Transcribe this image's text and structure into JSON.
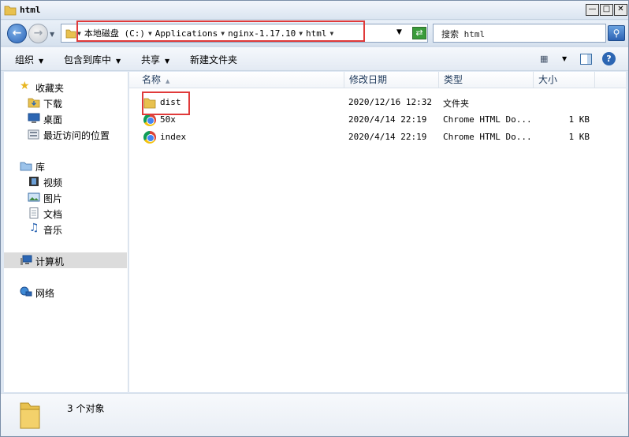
{
  "window": {
    "title": "html",
    "min_glyph": "—",
    "max_glyph": "□",
    "close_glyph": "✕"
  },
  "address": {
    "crumbs": [
      "本地磁盘 (C:)",
      "Applications",
      "nginx-1.17.10",
      "html"
    ],
    "dropdown_glyph": "▼"
  },
  "search": {
    "placeholder": "搜索 html"
  },
  "toolbar": {
    "organize": "组织",
    "include_in_library": "包含到库中",
    "share": "共享",
    "new_folder": "新建文件夹",
    "arrow": "▼"
  },
  "nav": {
    "favorites": "收藏夹",
    "downloads": "下载",
    "desktop": "桌面",
    "recent": "最近访问的位置",
    "libraries": "库",
    "videos": "视频",
    "pictures": "图片",
    "documents": "文档",
    "music": "音乐",
    "computer": "计算机",
    "network": "网络"
  },
  "columns": {
    "name": "名称",
    "modified": "修改日期",
    "type": "类型",
    "size": "大小"
  },
  "files": [
    {
      "name": "dist",
      "modified": "2020/12/16 12:32",
      "type": "文件夹",
      "size": "",
      "icon": "folder-icon"
    },
    {
      "name": "50x",
      "modified": "2020/4/14 22:19",
      "type": "Chrome HTML Do...",
      "size": "1 KB",
      "icon": "chrome-html-icon"
    },
    {
      "name": "index",
      "modified": "2020/4/14 22:19",
      "type": "Chrome HTML Do...",
      "size": "1 KB",
      "icon": "chrome-html-icon"
    }
  ],
  "details": {
    "count_text": "3 个对象"
  },
  "colors": {
    "highlight": "#e03a3a",
    "folder": "#e8c14f"
  }
}
